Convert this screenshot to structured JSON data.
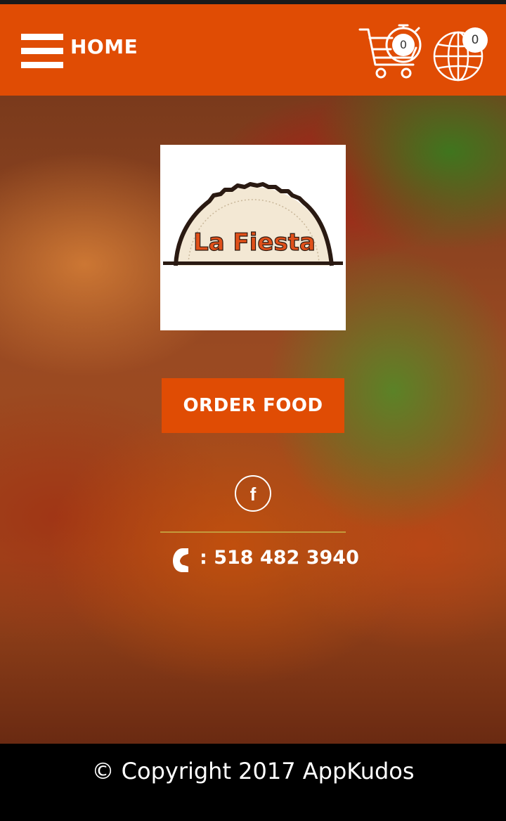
{
  "header": {
    "title": "HOME",
    "cart_count": "0",
    "language_count": "0"
  },
  "icons": {
    "menu": "hamburger-menu-icon",
    "cart": "shopping-cart-icon",
    "language": "globe-icon",
    "facebook": "facebook-icon",
    "phone": "phone-icon"
  },
  "logo": {
    "text": "La Fiesta"
  },
  "main": {
    "order_button_label": "ORDER FOOD",
    "phone_text": ": 518 482 3940"
  },
  "footer": {
    "copyright": "© Copyright 2017 AppKudos"
  },
  "colors": {
    "accent": "#e04c04",
    "header_bg": "#e04c04",
    "footer_bg": "#000000",
    "divider": "#c49a3c"
  }
}
